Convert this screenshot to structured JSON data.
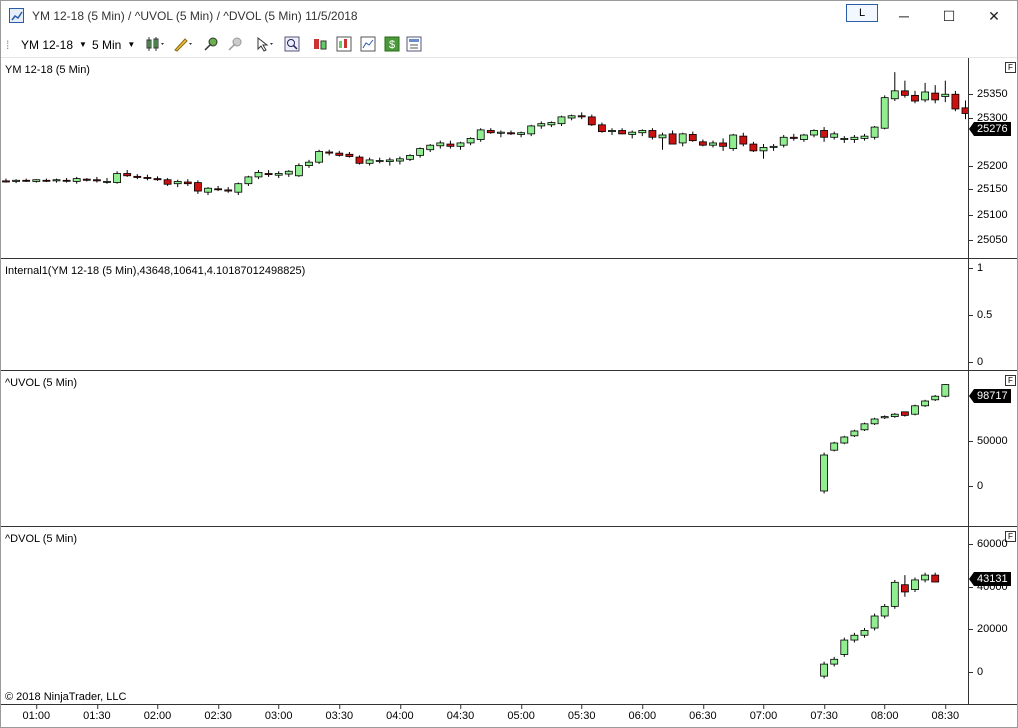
{
  "window": {
    "title": "YM 12-18 (5 Min) / ^UVOL (5 Min) / ^DVOL (5 Min)  11/5/2018",
    "link_label": "L",
    "minimize": "─",
    "maximize": "☐",
    "close": "✕"
  },
  "toolbar": {
    "instrument": "YM 12-18",
    "interval": "5 Min"
  },
  "colors": {
    "up": "#90ee90",
    "down": "#cc1111",
    "outline": "#000000"
  },
  "panels": [
    {
      "id": "price",
      "label": "YM 12-18 (5 Min)",
      "f": "F",
      "ticks": [
        "25350",
        "25300",
        "25250",
        "25200",
        "25150",
        "25100",
        "25050"
      ],
      "last": "25276"
    },
    {
      "id": "internal",
      "label": "Internal1(YM 12-18 (5 Min),43648,10641,4.10187012498825)",
      "ticks": [
        "1",
        "0.5",
        "0"
      ]
    },
    {
      "id": "uvol",
      "label": "^UVOL (5 Min)",
      "f": "F",
      "ticks": [
        "50000",
        "0"
      ],
      "last": "98717"
    },
    {
      "id": "dvol",
      "label": "^DVOL (5 Min)",
      "f": "F",
      "ticks": [
        "60000",
        "40000",
        "20000",
        "0"
      ],
      "last": "43131"
    }
  ],
  "x_axis": {
    "ticks": [
      "01:00",
      "01:30",
      "02:00",
      "02:30",
      "03:00",
      "03:30",
      "04:00",
      "04:30",
      "05:00",
      "05:30",
      "06:00",
      "06:30",
      "07:00",
      "07:30",
      "08:00",
      "08:30"
    ]
  },
  "copyright": "© 2018 NinjaTrader, LLC",
  "chart_data": [
    {
      "type": "candlestick",
      "title": "YM 12-18 (5 Min)",
      "x_start": "00:45",
      "x_interval_min": 5,
      "ylim": [
        25025,
        25380
      ],
      "series": [
        {
          "name": "YM 12-18",
          "ohlc": [
            [
              25163,
              25167,
              25160,
              25161
            ],
            [
              25162,
              25166,
              25159,
              25164
            ],
            [
              25164,
              25167,
              25161,
              25163
            ],
            [
              25162,
              25166,
              25160,
              25165
            ],
            [
              25164,
              25167,
              25161,
              25163
            ],
            [
              25163,
              25167,
              25160,
              25165
            ],
            [
              25164,
              25168,
              25160,
              25163
            ],
            [
              25162,
              25170,
              25158,
              25167
            ],
            [
              25166,
              25168,
              25162,
              25164
            ],
            [
              25165,
              25170,
              25160,
              25163
            ],
            [
              25162,
              25168,
              25158,
              25162
            ],
            [
              25160,
              25180,
              25158,
              25176
            ],
            [
              25176,
              25182,
              25170,
              25172
            ],
            [
              25171,
              25175,
              25166,
              25169
            ],
            [
              25169,
              25174,
              25164,
              25168
            ],
            [
              25167,
              25171,
              25163,
              25165
            ],
            [
              25165,
              25168,
              25154,
              25157
            ],
            [
              25158,
              25165,
              25152,
              25162
            ],
            [
              25161,
              25166,
              25154,
              25158
            ],
            [
              25160,
              25164,
              25140,
              25145
            ],
            [
              25143,
              25152,
              25138,
              25150
            ],
            [
              25149,
              25154,
              25145,
              25148
            ],
            [
              25147,
              25152,
              25142,
              25145
            ],
            [
              25143,
              25160,
              25138,
              25158
            ],
            [
              25158,
              25172,
              25154,
              25170
            ],
            [
              25170,
              25182,
              25166,
              25178
            ],
            [
              25176,
              25182,
              25170,
              25174
            ],
            [
              25173,
              25180,
              25168,
              25176
            ],
            [
              25175,
              25182,
              25170,
              25180
            ],
            [
              25172,
              25194,
              25170,
              25190
            ],
            [
              25190,
              25200,
              25186,
              25196
            ],
            [
              25196,
              25218,
              25193,
              25215
            ],
            [
              25214,
              25218,
              25208,
              25212
            ],
            [
              25212,
              25216,
              25206,
              25208
            ],
            [
              25210,
              25214,
              25204,
              25206
            ],
            [
              25205,
              25208,
              25192,
              25194
            ],
            [
              25194,
              25204,
              25190,
              25200
            ],
            [
              25198,
              25204,
              25194,
              25199
            ],
            [
              25197,
              25204,
              25190,
              25200
            ],
            [
              25198,
              25206,
              25192,
              25202
            ],
            [
              25201,
              25210,
              25198,
              25208
            ],
            [
              25208,
              25222,
              25204,
              25220
            ],
            [
              25218,
              25228,
              25214,
              25226
            ],
            [
              25225,
              25234,
              25220,
              25230
            ],
            [
              25228,
              25234,
              25220,
              25224
            ],
            [
              25224,
              25232,
              25218,
              25230
            ],
            [
              25230,
              25240,
              25226,
              25238
            ],
            [
              25236,
              25256,
              25232,
              25253
            ],
            [
              25252,
              25256,
              25246,
              25248
            ],
            [
              25247,
              25252,
              25240,
              25249
            ],
            [
              25248,
              25252,
              25244,
              25246
            ],
            [
              25245,
              25250,
              25240,
              25248
            ],
            [
              25246,
              25262,
              25242,
              25260
            ],
            [
              25260,
              25268,
              25255,
              25264
            ],
            [
              25262,
              25268,
              25258,
              25266
            ],
            [
              25264,
              25278,
              25260,
              25276
            ],
            [
              25274,
              25280,
              25270,
              25278
            ],
            [
              25278,
              25284,
              25272,
              25276
            ],
            [
              25276,
              25280,
              25260,
              25262
            ],
            [
              25262,
              25266,
              25248,
              25250
            ],
            [
              25250,
              25256,
              25244,
              25252
            ],
            [
              25252,
              25256,
              25245,
              25246
            ],
            [
              25245,
              25252,
              25238,
              25249
            ],
            [
              25248,
              25254,
              25242,
              25252
            ],
            [
              25252,
              25256,
              25236,
              25240
            ],
            [
              25239,
              25248,
              25218,
              25244
            ],
            [
              25246,
              25252,
              25238,
              25228
            ],
            [
              25230,
              25248,
              25224,
              25246
            ],
            [
              25245,
              25250,
              25232,
              25234
            ],
            [
              25232,
              25236,
              25224,
              25226
            ],
            [
              25226,
              25234,
              25222,
              25230
            ],
            [
              25230,
              25238,
              25216,
              25224
            ],
            [
              25220,
              25246,
              25216,
              25244
            ],
            [
              25242,
              25248,
              25224,
              25228
            ],
            [
              25228,
              25232,
              25214,
              25216
            ],
            [
              25216,
              25228,
              25202,
              25222
            ],
            [
              25222,
              25228,
              25216,
              25224
            ],
            [
              25226,
              25244,
              25222,
              25240
            ],
            [
              25240,
              25246,
              25234,
              25238
            ],
            [
              25236,
              25246,
              25232,
              25244
            ],
            [
              25244,
              25254,
              25240,
              25252
            ],
            [
              25252,
              25258,
              25232,
              25240
            ],
            [
              25240,
              25250,
              25236,
              25246
            ],
            [
              25236,
              25242,
              25230,
              25238
            ],
            [
              25236,
              25244,
              25230,
              25240
            ],
            [
              25238,
              25246,
              25234,
              25242
            ],
            [
              25240,
              25260,
              25236,
              25258
            ],
            [
              25256,
              25314,
              25254,
              25310
            ],
            [
              25308,
              25355,
              25304,
              25322
            ],
            [
              25322,
              25340,
              25310,
              25314
            ],
            [
              25314,
              25322,
              25300,
              25304
            ],
            [
              25306,
              25336,
              25302,
              25320
            ],
            [
              25318,
              25332,
              25300,
              25306
            ],
            [
              25312,
              25340,
              25302,
              25316
            ],
            [
              25316,
              25322,
              25286,
              25290
            ],
            [
              25292,
              25305,
              25272,
              25282
            ],
            [
              25282,
              25290,
              25246,
              25252
            ],
            [
              25248,
              25262,
              25244,
              25254
            ],
            [
              25244,
              25262,
              25222,
              25252
            ],
            [
              25254,
              25282,
              25240,
              25276
            ]
          ]
        }
      ]
    },
    {
      "type": "candlestick",
      "title": "^UVOL (5 Min)",
      "x_start": "07:30",
      "x_interval_min": 5,
      "ylim": [
        -20000,
        110000
      ],
      "series": [
        {
          "name": "^UVOL",
          "ohlc": [
            [
              10000,
              42000,
              8000,
              40000
            ],
            [
              44000,
              51000,
              43000,
              50000
            ],
            [
              50000,
              56000,
              49000,
              55000
            ],
            [
              56000,
              61000,
              55000,
              60000
            ],
            [
              61000,
              67000,
              60000,
              66000
            ],
            [
              66000,
              71000,
              65000,
              70000
            ],
            [
              71000,
              73000,
              70000,
              72000
            ],
            [
              72000,
              75000,
              71000,
              74000
            ],
            [
              76000,
              74000,
              72000,
              73000
            ],
            [
              74000,
              82000,
              73000,
              81000
            ],
            [
              81000,
              86000,
              80000,
              85000
            ],
            [
              86000,
              90000,
              85000,
              89000
            ],
            [
              89000,
              99000,
              88000,
              98717
            ]
          ]
        }
      ]
    },
    {
      "type": "candlestick",
      "title": "^DVOL (5 Min)",
      "x_start": "07:30",
      "x_interval_min": 5,
      "ylim": [
        -8000,
        66000
      ],
      "series": [
        {
          "name": "^DVOL",
          "ohlc": [
            [
              4000,
              10000,
              3000,
              9000
            ],
            [
              9000,
              12000,
              8000,
              11000
            ],
            [
              13000,
              20000,
              12000,
              19000
            ],
            [
              19000,
              22000,
              18000,
              21000
            ],
            [
              21000,
              24000,
              20000,
              23000
            ],
            [
              24000,
              30000,
              23000,
              29000
            ],
            [
              29000,
              34000,
              28000,
              33000
            ],
            [
              33000,
              44000,
              32000,
              43000
            ],
            [
              42000,
              46000,
              37000,
              39000
            ],
            [
              40000,
              45000,
              39000,
              44000
            ],
            [
              44000,
              47000,
              43000,
              46000
            ],
            [
              46000,
              47000,
              43000,
              43131
            ]
          ]
        }
      ]
    }
  ]
}
